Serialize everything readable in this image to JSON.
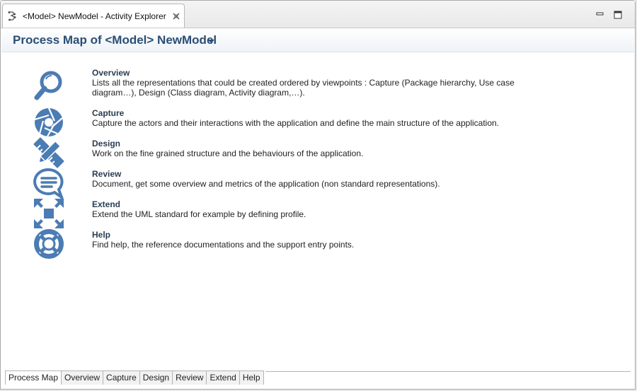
{
  "tab": {
    "title": "<Model> NewModel - Activity Explorer"
  },
  "header": {
    "title": "Process Map of <Model> NewModel"
  },
  "items": [
    {
      "title": "Overview",
      "desc": "Lists all the representations that could be created ordered by viewpoints : Capture (Package hierarchy, Use case diagram…), Design (Class diagram, Activity diagram,…).",
      "icon": "magnifier-icon"
    },
    {
      "title": "Capture",
      "desc": "Capture the actors and their interactions with the application and define the main structure of the application.",
      "icon": "aperture-icon"
    },
    {
      "title": "Design",
      "desc": "Work on the fine grained structure and the behaviours of the application.",
      "icon": "pencil-ruler-icon"
    },
    {
      "title": "Review",
      "desc": "Document, get some overview and metrics of the application (non standard representations).",
      "icon": "speech-bubble-icon"
    },
    {
      "title": "Extend",
      "desc": "Extend the UML standard for example by defining profile.",
      "icon": "expand-arrows-icon"
    },
    {
      "title": "Help",
      "desc": "Find help, the reference documentations and the support entry points.",
      "icon": "lifebuoy-icon"
    }
  ],
  "bottom_tabs": [
    "Process Map",
    "Overview",
    "Capture",
    "Design",
    "Review",
    "Extend",
    "Help"
  ],
  "colors": {
    "icon_blue": "#4b7cb3",
    "title_blue": "#2b4e74"
  }
}
